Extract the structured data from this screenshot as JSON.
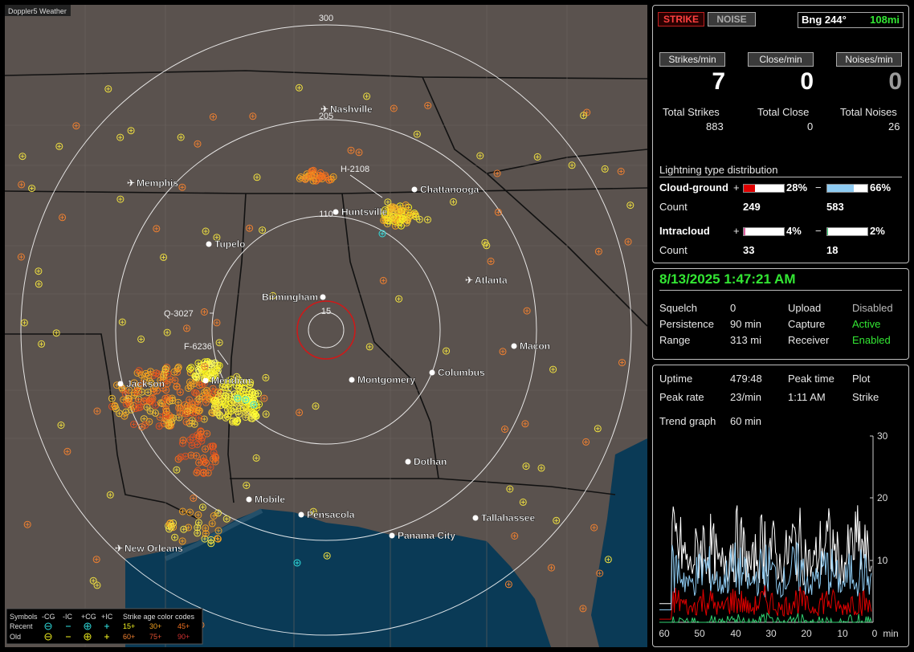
{
  "app": {
    "title": "Doppler5 Weather"
  },
  "map": {
    "range_labels": [
      "300",
      "205",
      "110",
      "15"
    ],
    "cities": [
      "Nashville",
      "Memphis",
      "Chattanooga",
      "Huntsville",
      "Tupelo",
      "Atlanta",
      "Birmingham",
      "Macon",
      "Jackson",
      "Meridian",
      "Montgomery",
      "Columbus",
      "Dothan",
      "Mobile",
      "Pensacola",
      "Tallahassee",
      "Panama City",
      "New Orleans"
    ],
    "storm_tags": [
      "H-2108",
      "Q-3027",
      "F-6236"
    ],
    "legend": {
      "symbols_label": "Symbols",
      "headers": [
        "-CG",
        "-IC",
        "+CG",
        "+IC"
      ],
      "recent_label": "Recent",
      "old_label": "Old",
      "age_title": "Strike age color codes",
      "age_recent": [
        "15+",
        "30+",
        "45+"
      ],
      "age_old": [
        "60+",
        "75+",
        "90+"
      ]
    }
  },
  "status": {
    "strike_label": "STRIKE",
    "noise_label": "NOISE",
    "bearing": "Bng 244°",
    "distance": "108mi",
    "rates": [
      {
        "label": "Strikes/min",
        "value": "7",
        "total_label": "Total Strikes",
        "total": "883"
      },
      {
        "label": "Close/min",
        "value": "0",
        "total_label": "Total Close",
        "total": "0"
      },
      {
        "label": "Noises/min",
        "value": "0",
        "total_label": "Total Noises",
        "total": "26"
      }
    ],
    "distribution": {
      "title": "Lightning type distribution",
      "cg_label": "Cloud-ground",
      "cg_pos_pct": "28%",
      "cg_neg_pct": "66%",
      "cg_pos_fraction": 0.28,
      "cg_neg_fraction": 0.66,
      "count_label": "Count",
      "cg_pos_count": "249",
      "cg_neg_count": "583",
      "ic_label": "Intracloud",
      "ic_pos_pct": "4%",
      "ic_neg_pct": "2%",
      "ic_pos_fraction": 0.04,
      "ic_neg_fraction": 0.02,
      "ic_pos_count": "33",
      "ic_neg_count": "18",
      "plus": "+",
      "minus": "−"
    }
  },
  "settings": {
    "datetime": "8/13/2025 1:47:21 AM",
    "rows": [
      {
        "k": "Squelch",
        "v": "0",
        "k2": "Upload",
        "v2": "Disabled"
      },
      {
        "k": "Persistence",
        "v": "90 min",
        "k2": "Capture",
        "v2": "Active"
      },
      {
        "k": "Range",
        "v": "313 mi",
        "k2": "Receiver",
        "v2": "Enabled"
      }
    ]
  },
  "trend": {
    "uptime_label": "Uptime",
    "uptime": "479:48",
    "peak_time_label": "Peak time",
    "peak_time": "1:11 AM",
    "plot_label": "Plot",
    "plot_value": "Strike",
    "peak_rate_label": "Peak rate",
    "peak_rate": "23/min",
    "graph_label": "Trend graph",
    "graph_span": "60 min",
    "x_ticks": [
      "60",
      "50",
      "40",
      "30",
      "20",
      "10",
      "0"
    ],
    "x_unit": "min",
    "y_ticks": [
      "30",
      "20",
      "10"
    ]
  },
  "colors": {
    "accent_green": "#33e633",
    "cg_pos": "#e00000",
    "cg_neg": "#8ecbf2",
    "ic_pos": "#e060a0",
    "ic_neg": "#30d070",
    "land": "#5a524e",
    "water": "#0a3a56"
  }
}
